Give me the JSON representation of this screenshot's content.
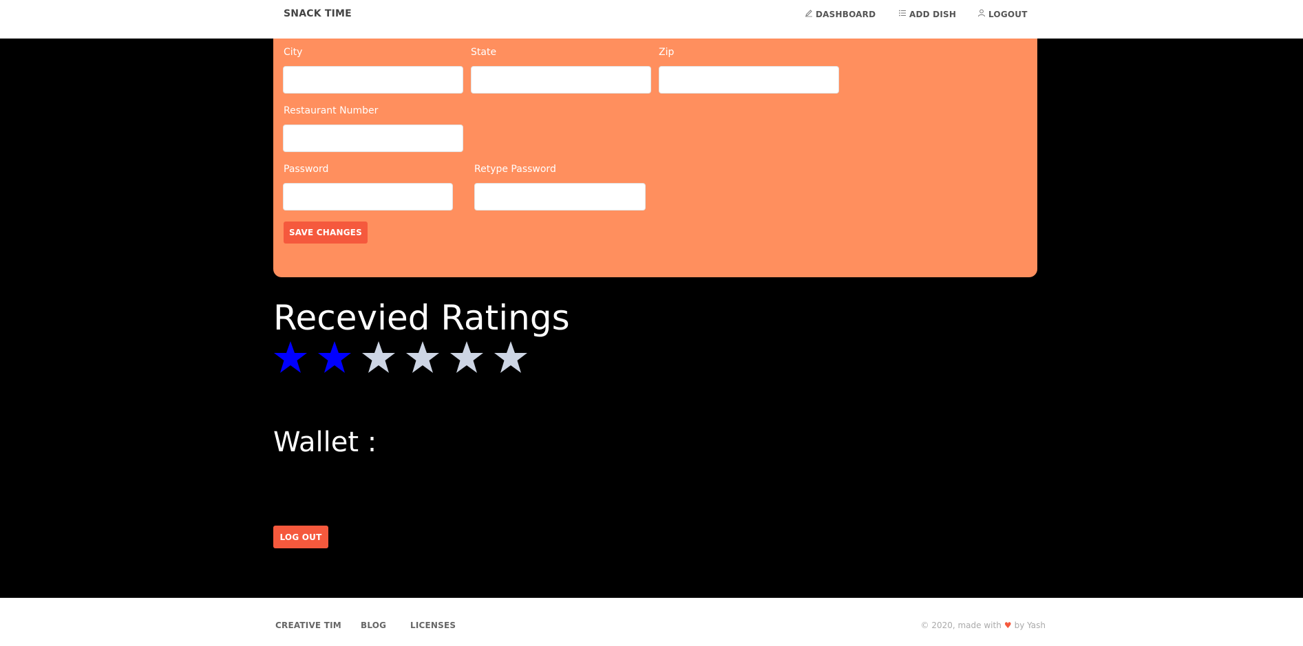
{
  "nav": {
    "brand": "SNACK TIME",
    "items": [
      {
        "label": "DASHBOARD",
        "icon": "pencil-icon"
      },
      {
        "label": "ADD DISH",
        "icon": "list-icon"
      },
      {
        "label": "LOGOUT",
        "icon": "user-icon"
      }
    ]
  },
  "form": {
    "city_label": "City",
    "state_label": "State",
    "zip_label": "Zip",
    "restaurant_number_label": "Restaurant Number",
    "password_label": "Password",
    "retype_password_label": "Retype Password",
    "city_value": "",
    "state_value": "",
    "zip_value": "",
    "restaurant_number_value": "",
    "password_value": "",
    "retype_password_value": "",
    "save_label": "SAVE CHANGES"
  },
  "ratings": {
    "title": "Recevied Ratings",
    "filled": 2,
    "total": 6,
    "filled_color": "#0000ff",
    "empty_color": "#cdd5e4"
  },
  "wallet": {
    "label": "Wallet :"
  },
  "logout_button": "LOG OUT",
  "footer": {
    "links": [
      "CREATIVE TIM",
      "BLOG",
      "LICENSES"
    ],
    "credit_prefix": "© 2020, made with",
    "credit_suffix": "by Yash"
  },
  "colors": {
    "accent": "#f5593d",
    "card": "#ff8f5e",
    "background": "#000000"
  }
}
